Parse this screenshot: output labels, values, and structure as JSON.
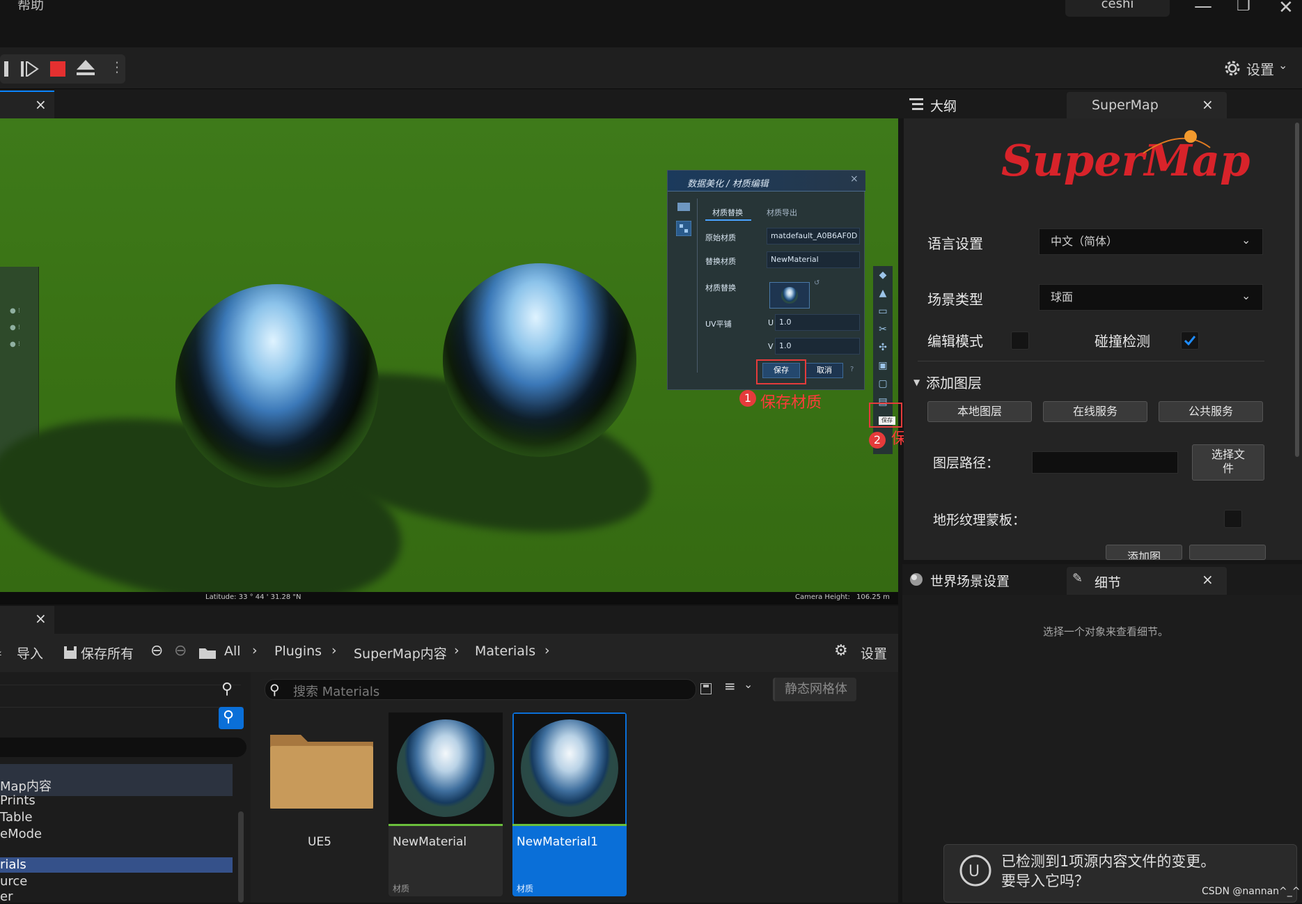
{
  "titlebar": {
    "menu_help": "帮助",
    "project": "ceshi",
    "min": "—",
    "restore": "❐",
    "close": "✕"
  },
  "toolbar": {
    "settings_label": "设置"
  },
  "viewport": {
    "tab_close": "×",
    "status_left": "Latitude: 33 ° 44 ' 31.28 \"N",
    "status_right_label": "Camera Height:",
    "status_right_value": "106.25 m"
  },
  "material_panel": {
    "title": "数据美化 / 材质编辑",
    "tab_replace": "材质替换",
    "tab_export": "材质导出",
    "orig_label": "原始材质",
    "orig_value": "matdefault_A0B6AF0D",
    "replace_label": "替换材质",
    "replace_value": "NewMaterial",
    "swap_label": "材质替换",
    "uv_label": "UV平铺",
    "u_label": "U",
    "u_value": "1.0",
    "v_label": "V",
    "v_value": "1.0",
    "save": "保存",
    "cancel": "取消",
    "close": "×",
    "tooltip_save": "保存"
  },
  "annotations": {
    "n1": "1",
    "label1": "保存材质",
    "n2": "2",
    "label2": "保存场景"
  },
  "right_panel": {
    "tab_outline": "大纲",
    "tab_supermap": "SuperMap",
    "tab_close": "×",
    "logo": "SuperMap",
    "lang_label": "语言设置",
    "lang_value": "中文（简体）",
    "scene_label": "场景类型",
    "scene_value": "球面",
    "edit_label": "编辑模式",
    "edit_checked": false,
    "collision_label": "碰撞检测",
    "collision_checked": true,
    "add_layer": "添加图层",
    "btn_local": "本地图层",
    "btn_online": "在线服务",
    "btn_public": "公共服务",
    "path_label": "图层路径：",
    "choose_file_1": "选择文",
    "choose_file_2": "件",
    "terrain_label": "地形纹理蒙板：",
    "add_btn": "添加图"
  },
  "details": {
    "tab_world": "世界场景设置",
    "tab_details": "细节",
    "tab_close": "×",
    "empty_text": "选择一个对象来查看细节。"
  },
  "content_browser": {
    "tab_close": "×",
    "import": "导入",
    "save_all": "保存所有",
    "crumbs": [
      "All",
      "Plugins",
      "SuperMap内容",
      "Materials"
    ],
    "settings": "设置",
    "search_placeholder": "搜索 Materials",
    "filter_chip": "静态网格体",
    "tree_items": [
      "Map内容",
      "Prints",
      "Table",
      "eMode",
      "rials",
      "urce",
      "er"
    ],
    "assets": [
      {
        "name": "UE5",
        "type": ""
      },
      {
        "name": "NewMaterial",
        "type": "材质"
      },
      {
        "name": "NewMaterial1",
        "type": "材质"
      }
    ]
  },
  "notification": {
    "line1": "已检测到1项源内容文件的变更。",
    "line2": "要导入它吗？"
  },
  "watermark": "CSDN @nannan^_^",
  "colors": {
    "accent": "#0a84ff",
    "annotation": "#e53b3b",
    "viewport_ground": "#3a7315"
  }
}
